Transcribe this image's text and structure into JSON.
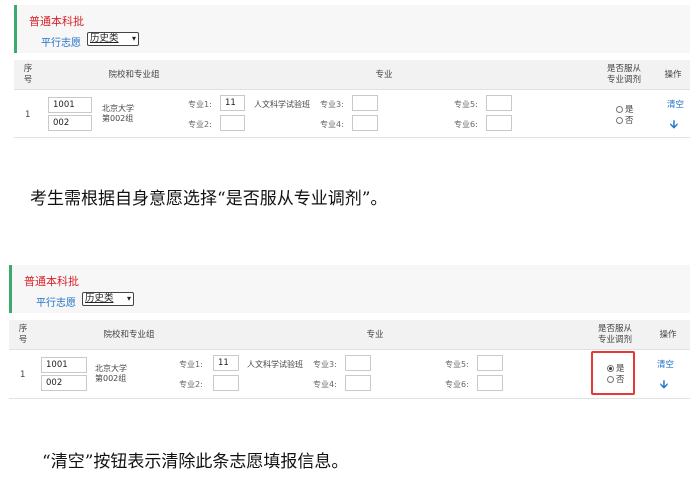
{
  "panels": [
    {
      "batch_title": "普通本科批",
      "mode_label": "平行志愿",
      "category_select": "历史类",
      "headers": {
        "seq": "序\n号",
        "school": "院校和专业组",
        "major": "专业",
        "adjust": "是否服从\n专业调剂",
        "action": "操作"
      },
      "row": {
        "seq": "1",
        "school_code": "1001",
        "group_code": "002",
        "school_name": "北京大学\n第002组",
        "major1_label": "专业1:",
        "major1_value": "11",
        "major1_name": "人文科学试验班",
        "major2_label": "专业2:",
        "major2_value": "",
        "major3_label": "专业3:",
        "major3_value": "",
        "major4_label": "专业4:",
        "major4_value": "",
        "major5_label": "专业5:",
        "major5_value": "",
        "major6_label": "专业6:",
        "major6_value": "",
        "adjust_yes": "是",
        "adjust_no": "否",
        "adjust_selected": "none",
        "clear_label": "清空",
        "move_down_icon": "arrow-down-icon"
      }
    },
    {
      "batch_title": "普通本科批",
      "mode_label": "平行志愿",
      "category_select": "历史类",
      "headers": {
        "seq": "序\n号",
        "school": "院校和专业组",
        "major": "专业",
        "adjust": "是否服从\n专业调剂",
        "action": "操作"
      },
      "row": {
        "seq": "1",
        "school_code": "1001",
        "group_code": "002",
        "school_name": "北京大学\n第002组",
        "major1_label": "专业1:",
        "major1_value": "11",
        "major1_name": "人文科学试验班",
        "major2_label": "专业2:",
        "major2_value": "",
        "major3_label": "专业3:",
        "major3_value": "",
        "major4_label": "专业4:",
        "major4_value": "",
        "major5_label": "专业5:",
        "major5_value": "",
        "major6_label": "专业6:",
        "major6_value": "",
        "adjust_yes": "是",
        "adjust_no": "否",
        "adjust_selected": "yes",
        "clear_label": "清空",
        "move_down_icon": "arrow-down-icon"
      }
    }
  ],
  "captions": {
    "adjust_tip": "考生需根据自身意愿选择“是否服从专业调剂”。",
    "clear_tip": "“清空”按钮表示清除此条志愿填报信息。"
  },
  "colors": {
    "batch_red": "#d8232a",
    "link_blue": "#2271c9",
    "accent_green": "#3caa6f",
    "highlight_red": "#e53935"
  }
}
